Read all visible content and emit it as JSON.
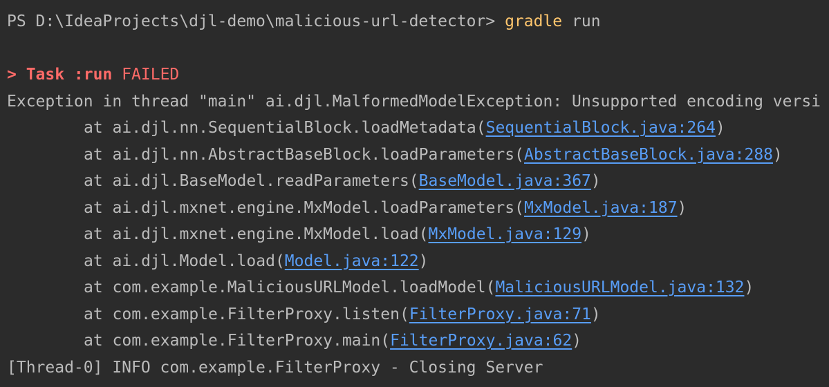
{
  "terminal": {
    "prompt": "PS D:\\IdeaProjects\\djl-demo\\malicious-url-detector> ",
    "command": "gradle",
    "command_args": " run",
    "task_marker": "> Task :run",
    "task_status": " FAILED",
    "exception": "Exception in thread \"main\" ai.djl.MalformedModelException: Unsupported encoding versi",
    "stack": [
      {
        "method": "at ai.djl.nn.SequentialBlock.loadMetadata(",
        "link": "SequentialBlock.java:264"
      },
      {
        "method": "at ai.djl.nn.AbstractBaseBlock.loadParameters(",
        "link": "AbstractBaseBlock.java:288"
      },
      {
        "method": "at ai.djl.BaseModel.readParameters(",
        "link": "BaseModel.java:367"
      },
      {
        "method": "at ai.djl.mxnet.engine.MxModel.loadParameters(",
        "link": "MxModel.java:187"
      },
      {
        "method": "at ai.djl.mxnet.engine.MxModel.load(",
        "link": "MxModel.java:129"
      },
      {
        "method": "at ai.djl.Model.load(",
        "link": "Model.java:122"
      },
      {
        "method": "at com.example.MaliciousURLModel.loadModel(",
        "link": "MaliciousURLModel.java:132"
      },
      {
        "method": "at com.example.FilterProxy.listen(",
        "link": "FilterProxy.java:71"
      },
      {
        "method": "at com.example.FilterProxy.main(",
        "link": "FilterProxy.java:62"
      }
    ],
    "close_paren": ")",
    "info_line": "[Thread-0] INFO com.example.FilterProxy - Closing Server",
    "cut_line": "    ...                     "
  },
  "colors": {
    "background": "#2b2b2b",
    "text": "#bbbbbb",
    "command": "#ffc66d",
    "failed": "#ff6b68",
    "link": "#589df6"
  }
}
